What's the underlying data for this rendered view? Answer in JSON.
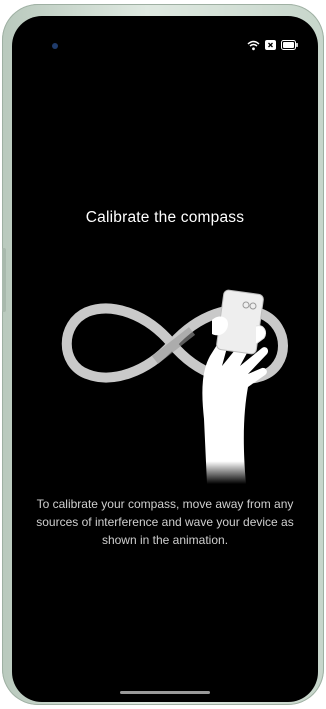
{
  "screen": {
    "title": "Calibrate the compass",
    "instructions": "To calibrate your compass, move away from any sources of interference and wave your device as shown in the animation."
  },
  "status_bar": {
    "icons": [
      "wifi-icon",
      "close-box-icon",
      "battery-icon"
    ]
  },
  "illustration": {
    "description_icons": [
      "infinity-path-icon",
      "hand-holding-phone-icon"
    ]
  },
  "colors": {
    "background": "#000000",
    "text": "#ffffff",
    "instruction_text": "#cfcfcf",
    "infinity_path": "#c9c9c9",
    "hand": "#ffffff"
  }
}
